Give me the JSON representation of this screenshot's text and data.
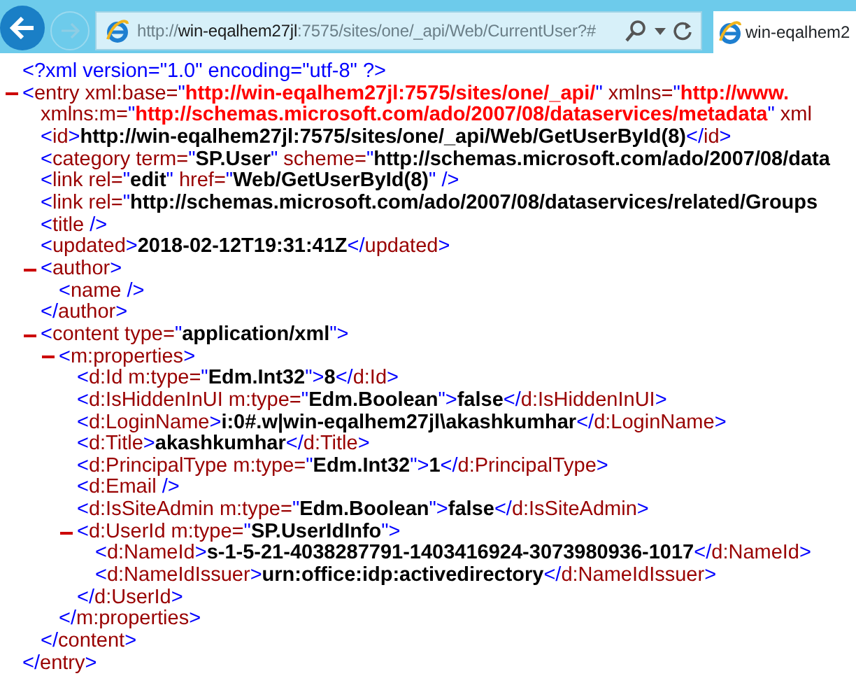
{
  "browser": {
    "url": {
      "scheme": "http://",
      "host": "win-eqalhem27jl",
      "rest": ":7575/sites/one/_api/Web/CurrentUser?#"
    },
    "tab": {
      "title": "win-eqalhem2",
      "selected": true
    }
  },
  "document": [
    {
      "lines": [
        [
          {
            "kind": "p",
            "text": "<?xml version=\"1.0\" encoding=\"utf-8\" ?>"
          }
        ]
      ]
    },
    {
      "expanded": true,
      "lines": [
        [
          {
            "kind": "p",
            "text": "<"
          },
          {
            "kind": "n",
            "text": "entry xml:base="
          },
          {
            "kind": "p",
            "text": "\""
          },
          {
            "kind": "r",
            "text": "http://win-eqalhem27jl:7575/sites/one/_api/"
          },
          {
            "kind": "p",
            "text": "\""
          },
          {
            "kind": "n",
            "text": " xmlns="
          },
          {
            "kind": "p",
            "text": "\""
          },
          {
            "kind": "r",
            "text": "http://www."
          }
        ],
        [
          {
            "kind": "n",
            "text": "xmlns:m="
          },
          {
            "kind": "p",
            "text": "\""
          },
          {
            "kind": "r",
            "text": "http://schemas.microsoft.com/ado/2007/08/dataservices/metadata"
          },
          {
            "kind": "p",
            "text": "\""
          },
          {
            "kind": "n",
            "text": " xml"
          }
        ]
      ],
      "children": [
        {
          "lines": [
            [
              {
                "kind": "p",
                "text": "<"
              },
              {
                "kind": "n",
                "text": "id"
              },
              {
                "kind": "p",
                "text": ">"
              },
              {
                "kind": "v",
                "text": "http://win-eqalhem27jl:7575/sites/one/_api/Web/GetUserById(8)"
              },
              {
                "kind": "p",
                "text": "</"
              },
              {
                "kind": "n",
                "text": "id"
              },
              {
                "kind": "p",
                "text": ">"
              }
            ]
          ]
        },
        {
          "lines": [
            [
              {
                "kind": "p",
                "text": "<"
              },
              {
                "kind": "n",
                "text": "category term="
              },
              {
                "kind": "p",
                "text": "\""
              },
              {
                "kind": "v",
                "text": "SP.User"
              },
              {
                "kind": "p",
                "text": "\""
              },
              {
                "kind": "n",
                "text": " scheme="
              },
              {
                "kind": "p",
                "text": "\""
              },
              {
                "kind": "v",
                "text": "http://schemas.microsoft.com/ado/2007/08/data"
              }
            ]
          ]
        },
        {
          "lines": [
            [
              {
                "kind": "p",
                "text": "<"
              },
              {
                "kind": "n",
                "text": "link rel="
              },
              {
                "kind": "p",
                "text": "\""
              },
              {
                "kind": "v",
                "text": "edit"
              },
              {
                "kind": "p",
                "text": "\""
              },
              {
                "kind": "n",
                "text": " href="
              },
              {
                "kind": "p",
                "text": "\""
              },
              {
                "kind": "v",
                "text": "Web/GetUserById(8)"
              },
              {
                "kind": "p",
                "text": "\" />"
              }
            ]
          ]
        },
        {
          "lines": [
            [
              {
                "kind": "p",
                "text": "<"
              },
              {
                "kind": "n",
                "text": "link rel="
              },
              {
                "kind": "p",
                "text": "\""
              },
              {
                "kind": "v",
                "text": "http://schemas.microsoft.com/ado/2007/08/dataservices/related/Groups"
              }
            ]
          ]
        },
        {
          "lines": [
            [
              {
                "kind": "p",
                "text": "<"
              },
              {
                "kind": "n",
                "text": "title"
              },
              {
                "kind": "p",
                "text": " />"
              }
            ]
          ]
        },
        {
          "lines": [
            [
              {
                "kind": "p",
                "text": "<"
              },
              {
                "kind": "n",
                "text": "updated"
              },
              {
                "kind": "p",
                "text": ">"
              },
              {
                "kind": "v",
                "text": "2018-02-12T19:31:41Z"
              },
              {
                "kind": "p",
                "text": "</"
              },
              {
                "kind": "n",
                "text": "updated"
              },
              {
                "kind": "p",
                "text": ">"
              }
            ]
          ]
        },
        {
          "expanded": true,
          "lines": [
            [
              {
                "kind": "p",
                "text": "<"
              },
              {
                "kind": "n",
                "text": "author"
              },
              {
                "kind": "p",
                "text": ">"
              }
            ]
          ],
          "children": [
            {
              "lines": [
                [
                  {
                    "kind": "p",
                    "text": "<"
                  },
                  {
                    "kind": "n",
                    "text": "name"
                  },
                  {
                    "kind": "p",
                    "text": " />"
                  }
                ]
              ]
            }
          ],
          "close": [
            {
              "kind": "p",
              "text": "</"
            },
            {
              "kind": "n",
              "text": "author"
            },
            {
              "kind": "p",
              "text": ">"
            }
          ]
        },
        {
          "expanded": true,
          "lines": [
            [
              {
                "kind": "p",
                "text": "<"
              },
              {
                "kind": "n",
                "text": "content type="
              },
              {
                "kind": "p",
                "text": "\""
              },
              {
                "kind": "v",
                "text": "application/xml"
              },
              {
                "kind": "p",
                "text": "\">"
              }
            ]
          ],
          "children": [
            {
              "expanded": true,
              "lines": [
                [
                  {
                    "kind": "p",
                    "text": "<"
                  },
                  {
                    "kind": "n",
                    "text": "m:properties"
                  },
                  {
                    "kind": "p",
                    "text": ">"
                  }
                ]
              ],
              "children": [
                {
                  "lines": [
                    [
                      {
                        "kind": "p",
                        "text": "<"
                      },
                      {
                        "kind": "n",
                        "text": "d:Id m:type="
                      },
                      {
                        "kind": "p",
                        "text": "\""
                      },
                      {
                        "kind": "v",
                        "text": "Edm.Int32"
                      },
                      {
                        "kind": "p",
                        "text": "\">"
                      },
                      {
                        "kind": "v",
                        "text": "8"
                      },
                      {
                        "kind": "p",
                        "text": "</"
                      },
                      {
                        "kind": "n",
                        "text": "d:Id"
                      },
                      {
                        "kind": "p",
                        "text": ">"
                      }
                    ]
                  ]
                },
                {
                  "lines": [
                    [
                      {
                        "kind": "p",
                        "text": "<"
                      },
                      {
                        "kind": "n",
                        "text": "d:IsHiddenInUI m:type="
                      },
                      {
                        "kind": "p",
                        "text": "\""
                      },
                      {
                        "kind": "v",
                        "text": "Edm.Boolean"
                      },
                      {
                        "kind": "p",
                        "text": "\">"
                      },
                      {
                        "kind": "v",
                        "text": "false"
                      },
                      {
                        "kind": "p",
                        "text": "</"
                      },
                      {
                        "kind": "n",
                        "text": "d:IsHiddenInUI"
                      },
                      {
                        "kind": "p",
                        "text": ">"
                      }
                    ]
                  ]
                },
                {
                  "lines": [
                    [
                      {
                        "kind": "p",
                        "text": "<"
                      },
                      {
                        "kind": "n",
                        "text": "d:LoginName"
                      },
                      {
                        "kind": "p",
                        "text": ">"
                      },
                      {
                        "kind": "v",
                        "text": "i:0#.w|win-eqalhem27jl\\akashkumhar"
                      },
                      {
                        "kind": "p",
                        "text": "</"
                      },
                      {
                        "kind": "n",
                        "text": "d:LoginName"
                      },
                      {
                        "kind": "p",
                        "text": ">"
                      }
                    ]
                  ]
                },
                {
                  "lines": [
                    [
                      {
                        "kind": "p",
                        "text": "<"
                      },
                      {
                        "kind": "n",
                        "text": "d:Title"
                      },
                      {
                        "kind": "p",
                        "text": ">"
                      },
                      {
                        "kind": "v",
                        "text": "akashkumhar"
                      },
                      {
                        "kind": "p",
                        "text": "</"
                      },
                      {
                        "kind": "n",
                        "text": "d:Title"
                      },
                      {
                        "kind": "p",
                        "text": ">"
                      }
                    ]
                  ]
                },
                {
                  "lines": [
                    [
                      {
                        "kind": "p",
                        "text": "<"
                      },
                      {
                        "kind": "n",
                        "text": "d:PrincipalType m:type="
                      },
                      {
                        "kind": "p",
                        "text": "\""
                      },
                      {
                        "kind": "v",
                        "text": "Edm.Int32"
                      },
                      {
                        "kind": "p",
                        "text": "\">"
                      },
                      {
                        "kind": "v",
                        "text": "1"
                      },
                      {
                        "kind": "p",
                        "text": "</"
                      },
                      {
                        "kind": "n",
                        "text": "d:PrincipalType"
                      },
                      {
                        "kind": "p",
                        "text": ">"
                      }
                    ]
                  ]
                },
                {
                  "lines": [
                    [
                      {
                        "kind": "p",
                        "text": "<"
                      },
                      {
                        "kind": "n",
                        "text": "d:Email"
                      },
                      {
                        "kind": "p",
                        "text": " />"
                      }
                    ]
                  ]
                },
                {
                  "lines": [
                    [
                      {
                        "kind": "p",
                        "text": "<"
                      },
                      {
                        "kind": "n",
                        "text": "d:IsSiteAdmin m:type="
                      },
                      {
                        "kind": "p",
                        "text": "\""
                      },
                      {
                        "kind": "v",
                        "text": "Edm.Boolean"
                      },
                      {
                        "kind": "p",
                        "text": "\">"
                      },
                      {
                        "kind": "v",
                        "text": "false"
                      },
                      {
                        "kind": "p",
                        "text": "</"
                      },
                      {
                        "kind": "n",
                        "text": "d:IsSiteAdmin"
                      },
                      {
                        "kind": "p",
                        "text": ">"
                      }
                    ]
                  ]
                },
                {
                  "expanded": true,
                  "lines": [
                    [
                      {
                        "kind": "p",
                        "text": "<"
                      },
                      {
                        "kind": "n",
                        "text": "d:UserId m:type="
                      },
                      {
                        "kind": "p",
                        "text": "\""
                      },
                      {
                        "kind": "v",
                        "text": "SP.UserIdInfo"
                      },
                      {
                        "kind": "p",
                        "text": "\">"
                      }
                    ]
                  ],
                  "children": [
                    {
                      "lines": [
                        [
                          {
                            "kind": "p",
                            "text": "<"
                          },
                          {
                            "kind": "n",
                            "text": "d:NameId"
                          },
                          {
                            "kind": "p",
                            "text": ">"
                          },
                          {
                            "kind": "v",
                            "text": "s-1-5-21-4038287791-1403416924-3073980936-1017"
                          },
                          {
                            "kind": "p",
                            "text": "</"
                          },
                          {
                            "kind": "n",
                            "text": "d:NameId"
                          },
                          {
                            "kind": "p",
                            "text": ">"
                          }
                        ]
                      ]
                    },
                    {
                      "lines": [
                        [
                          {
                            "kind": "p",
                            "text": "<"
                          },
                          {
                            "kind": "n",
                            "text": "d:NameIdIssuer"
                          },
                          {
                            "kind": "p",
                            "text": ">"
                          },
                          {
                            "kind": "v",
                            "text": "urn:office:idp:activedirectory"
                          },
                          {
                            "kind": "p",
                            "text": "</"
                          },
                          {
                            "kind": "n",
                            "text": "d:NameIdIssuer"
                          },
                          {
                            "kind": "p",
                            "text": ">"
                          }
                        ]
                      ]
                    }
                  ],
                  "close": [
                    {
                      "kind": "p",
                      "text": "</"
                    },
                    {
                      "kind": "n",
                      "text": "d:UserId"
                    },
                    {
                      "kind": "p",
                      "text": ">"
                    }
                  ]
                }
              ],
              "close": [
                {
                  "kind": "p",
                  "text": "</"
                },
                {
                  "kind": "n",
                  "text": "m:properties"
                },
                {
                  "kind": "p",
                  "text": ">"
                }
              ]
            }
          ],
          "close": [
            {
              "kind": "p",
              "text": "</"
            },
            {
              "kind": "n",
              "text": "content"
            },
            {
              "kind": "p",
              "text": ">"
            }
          ]
        }
      ],
      "close": [
        {
          "kind": "p",
          "text": "</"
        },
        {
          "kind": "n",
          "text": "entry"
        },
        {
          "kind": "p",
          "text": ">"
        }
      ]
    }
  ]
}
